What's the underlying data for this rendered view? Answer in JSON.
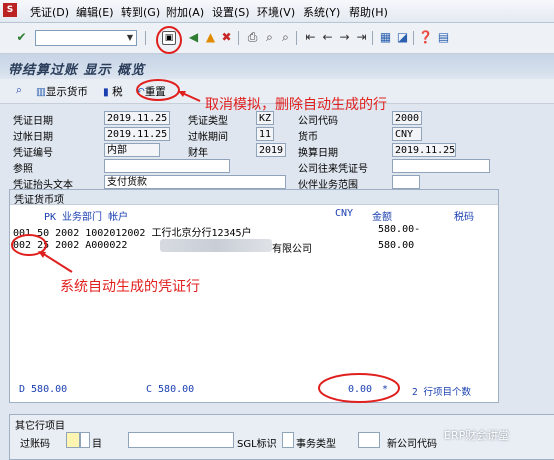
{
  "menu": [
    "凭证(D)",
    "编辑(E)",
    "转到(G)",
    "附加(A)",
    "设置(S)",
    "环境(V)",
    "系统(Y)",
    "帮助(H)"
  ],
  "title": "带结算过账 显示 概览",
  "app_toolbar": {
    "display_currency": "显示货币",
    "tax": "税",
    "reset": "重置"
  },
  "header": {
    "doc_date_label": "凭证日期",
    "doc_date": "2019.11.25",
    "doc_type_label": "凭证类型",
    "doc_type": "KZ",
    "company_code_label": "公司代码",
    "company_code": "2000",
    "posting_date_label": "过帐日期",
    "posting_date": "2019.11.25",
    "posting_period_label": "过帐期间",
    "posting_period": "11",
    "currency_label": "货币",
    "currency": "CNY",
    "doc_number_label": "凭证编号",
    "doc_number": "内部",
    "fiscal_year_label": "财年",
    "fiscal_year": "2019",
    "translation_date_label": "换算日期",
    "translation_date": "2019.11.25",
    "reference_label": "参照",
    "reference": "",
    "cross_cc_label": "公司往来凭证号",
    "cross_cc": "",
    "header_text_label": "凭证抬头文本",
    "header_text": "支付货款",
    "partner_area_label": "伙伴业务范围",
    "partner_area": ""
  },
  "items_group": {
    "title": "凭证货币项",
    "col_pk_dept_account": "PK 业务部门 帐户",
    "col_cny": "CNY",
    "col_amount": "金额",
    "col_tax": "税码",
    "rows": [
      {
        "text": "001 50  2002 1002012002 工行北京分行12345户",
        "amount": "580.00-"
      },
      {
        "text": "002 25  2002 A000022",
        "text2": "有限公司",
        "amount": "580.00"
      }
    ],
    "debit": "D 580.00",
    "credit": "C 580.00",
    "balance": "0.00",
    "balance_status": "*",
    "item_count": "2 行项目个数"
  },
  "other_group": {
    "title": "其它行项目",
    "posting_key_label": "过账码",
    "account_suffix": "目",
    "sgl_label": "SGL标识",
    "trans_type_label": "事务类型",
    "new_cc_label": "新公司代码"
  },
  "annotations": {
    "top": "取消模拟，删除自动生成的行",
    "middle": "系统自动生成的凭证行",
    "watermark": "ERP财会讲堂"
  },
  "colors": {
    "annotation": "#e0201e",
    "blue_text": "#1a3fb0"
  }
}
